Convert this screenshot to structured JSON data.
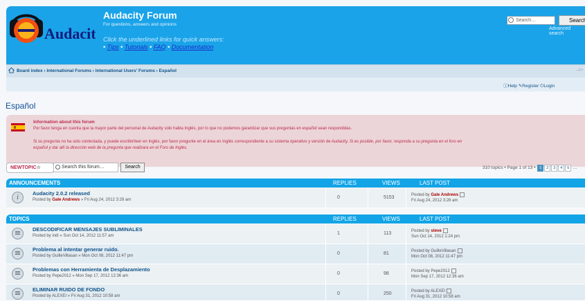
{
  "header": {
    "logo_text": "Audacity",
    "title": "Audacity Forum",
    "description": "For questions, answers and opinions",
    "quick_text": "Click the underlined links for quick answers:",
    "quick_links": [
      "Tips",
      "Tutorials",
      "FAQ",
      "Documentation"
    ],
    "search_placeholder": "Search…",
    "search_button": "Search",
    "advanced_search": "Advanced search",
    "accent": "#1aa3e8"
  },
  "nav": {
    "breadcrumb": "Board index ‹ International Forums ‹ International Users' Forums ‹ Español",
    "font_size": "–A+",
    "help": "Help",
    "register": "Register",
    "login": "Login"
  },
  "page_title": "Español",
  "notice": {
    "title": "Information about this forum",
    "line1": "Por favor tenga en cuenta que la mayor parte del personal de Audacity sólo habla Inglés, por lo que no podemos garantizar que sus preguntas en español sean respondidas.",
    "line2a": "Si su pregunta no ha sido contestada, y puede escribir/leer en Inglés, por favor pregunte en el área en Inglés correspondiente a su sistema operativo y versión de Audacity. ",
    "line2b": "Si es posible, por favor, responda a su pregunta en el foro en",
    "line3": "español y dar allí la dirección web de la pregunta que realizara en el Foro de Inglés."
  },
  "toolbar": {
    "newtopic": "NEWTOPIC",
    "search_value": "Search this forum…",
    "search_button": "Search",
    "pagination_text": "310 topics • Page 1 of 13 •",
    "pages": [
      "1",
      "2",
      "3",
      "4",
      "5"
    ],
    "pagination_more": "…"
  },
  "announcements": {
    "heading": "ANNOUNCEMENTS",
    "col_replies": "REPLIES",
    "col_views": "VIEWS",
    "col_last": "LAST POST",
    "rows": [
      {
        "title": "Audacity 2.0.2 released",
        "posted_by": "Posted by",
        "author": "Gale Andrews",
        "date": "» Fri Aug 24, 2012 3:28 am",
        "replies": "0",
        "views": "5153",
        "last_by": "Posted by",
        "last_author": "Gale Andrews",
        "last_date": "Fri Aug 24, 2012 3:28 am"
      }
    ]
  },
  "topics": {
    "heading": "TOPICS",
    "col_replies": "REPLIES",
    "col_views": "VIEWS",
    "col_last": "LAST POST",
    "rows": [
      {
        "title": "DESCODIFICAR MENSAJES SUBLIMINALES",
        "posted_by": "Posted by",
        "author": "indi",
        "date": "» Sun Oct 14, 2012 11:57 am",
        "replies": "1",
        "views": "113",
        "last_by": "Posted by",
        "last_author": "steve",
        "last_date": "Sun Oct 14, 2012 1:24 pm"
      },
      {
        "title": "Problema al intentar generar ruido.",
        "posted_by": "Posted by",
        "author": "GuilleVillasan",
        "date": "» Mon Oct 08, 2012 11:47 pm",
        "replies": "0",
        "views": "81",
        "last_by": "Posted by",
        "last_author": "GuilleVillasan",
        "last_date": "Mon Oct 08, 2012 11:47 pm"
      },
      {
        "title": "Problemas con Herramienta de Desplazamiento",
        "posted_by": "Posted by",
        "author": "Pepe2012",
        "date": "» Mon Sep 17, 2012 12:36 am",
        "replies": "0",
        "views": "98",
        "last_by": "Posted by",
        "last_author": "Pepe2012",
        "last_date": "Mon Sep 17, 2012 12:36 am"
      },
      {
        "title": "ELIMINAR RUIDO DE FONDO",
        "posted_by": "Posted by",
        "author": "ALEXEI",
        "date": "» Fri Aug 31, 2012 10:58 am",
        "replies": "0",
        "views": "250",
        "last_by": "Posted by",
        "last_author": "ALEXEI",
        "last_date": "Fri Aug 31, 2012 10:58 am"
      }
    ]
  }
}
